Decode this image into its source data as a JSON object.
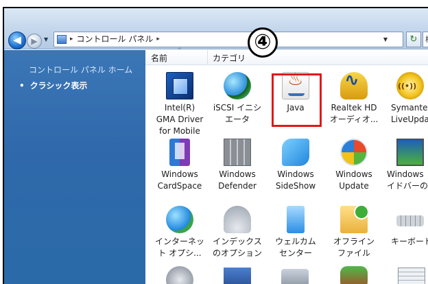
{
  "address": {
    "path": "コントロール パネル",
    "sep": "▸"
  },
  "search": {
    "placeholder": "検"
  },
  "taskpane": {
    "home_link": "コントロール パネル ホーム",
    "current": "クラシック表示",
    "bullet": "•"
  },
  "columns": {
    "name": "名前",
    "category": "カテゴリ",
    "sort_glyph": "^"
  },
  "callout": "④",
  "items": [
    {
      "label1": "Intel(R)",
      "label2": "GMA Driver",
      "label3": "for Mobile",
      "icon": "intel-gma-icon"
    },
    {
      "label1": "iSCSI イニシ",
      "label2": "エータ",
      "icon": "iscsi-icon"
    },
    {
      "label1": "Java",
      "icon": "java-icon"
    },
    {
      "label1": "Realtek HD",
      "label2": "オーディオ...",
      "icon": "realtek-icon"
    },
    {
      "label1": "Symante",
      "label2": "LiveUpdat",
      "icon": "symantec-icon"
    },
    {
      "label1": "Windows",
      "label2": "CardSpace",
      "icon": "cardspace-icon"
    },
    {
      "label1": "Windows",
      "label2": "Defender",
      "icon": "defender-icon"
    },
    {
      "label1": "Windows",
      "label2": "SideShow",
      "icon": "sideshow-icon"
    },
    {
      "label1": "Windows",
      "label2": "Update",
      "icon": "windows-update-icon"
    },
    {
      "label1": "Windows",
      "label2": "イドバーの",
      "icon": "windows-sidebar-icon"
    },
    {
      "label1": "インターネッ",
      "label2": "ト オプシ...",
      "icon": "internet-options-icon"
    },
    {
      "label1": "インデックス",
      "label2": "のオプション",
      "icon": "indexing-options-icon"
    },
    {
      "label1": "ウェルカム",
      "label2": "センター",
      "icon": "welcome-center-icon"
    },
    {
      "label1": "オフライン",
      "label2": "ファイル",
      "icon": "offline-files-icon"
    },
    {
      "label1": "キーボード",
      "icon": "keyboard-icon"
    }
  ],
  "highlight_color": "#e01818"
}
